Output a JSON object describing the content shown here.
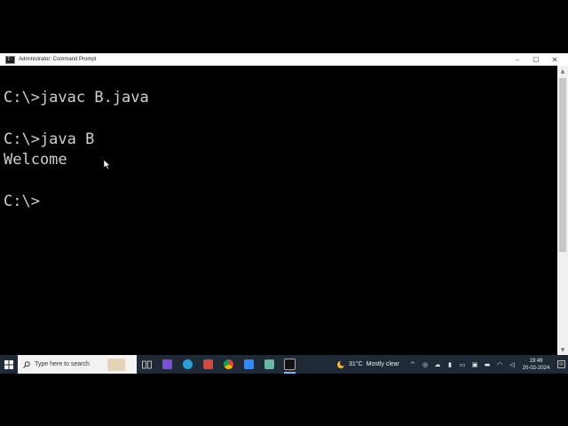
{
  "window": {
    "title": "Administrator: Command Prompt",
    "controls": {
      "minimize": "–",
      "maximize": "☐",
      "close": "✕"
    }
  },
  "console": {
    "lines": [
      "C:\\>javac B.java",
      "C:\\>java B",
      "Welcome",
      "C:\\>"
    ]
  },
  "taskbar": {
    "search_placeholder": "Type here to search",
    "weather": {
      "temp": "31°C",
      "condition": "Mostly clear"
    },
    "clock": {
      "time": "19:49",
      "date": "20-02-2024"
    },
    "apps": [
      "task-view-icon",
      "visual-studio-icon",
      "edge-icon",
      "app-icon",
      "chrome-icon",
      "zoom-icon",
      "explorer-icon",
      "command-prompt-icon"
    ]
  },
  "colors": {
    "console_bg": "#000000",
    "console_text": "#cfcfcf",
    "taskbar_bg": "#1f2a36"
  }
}
